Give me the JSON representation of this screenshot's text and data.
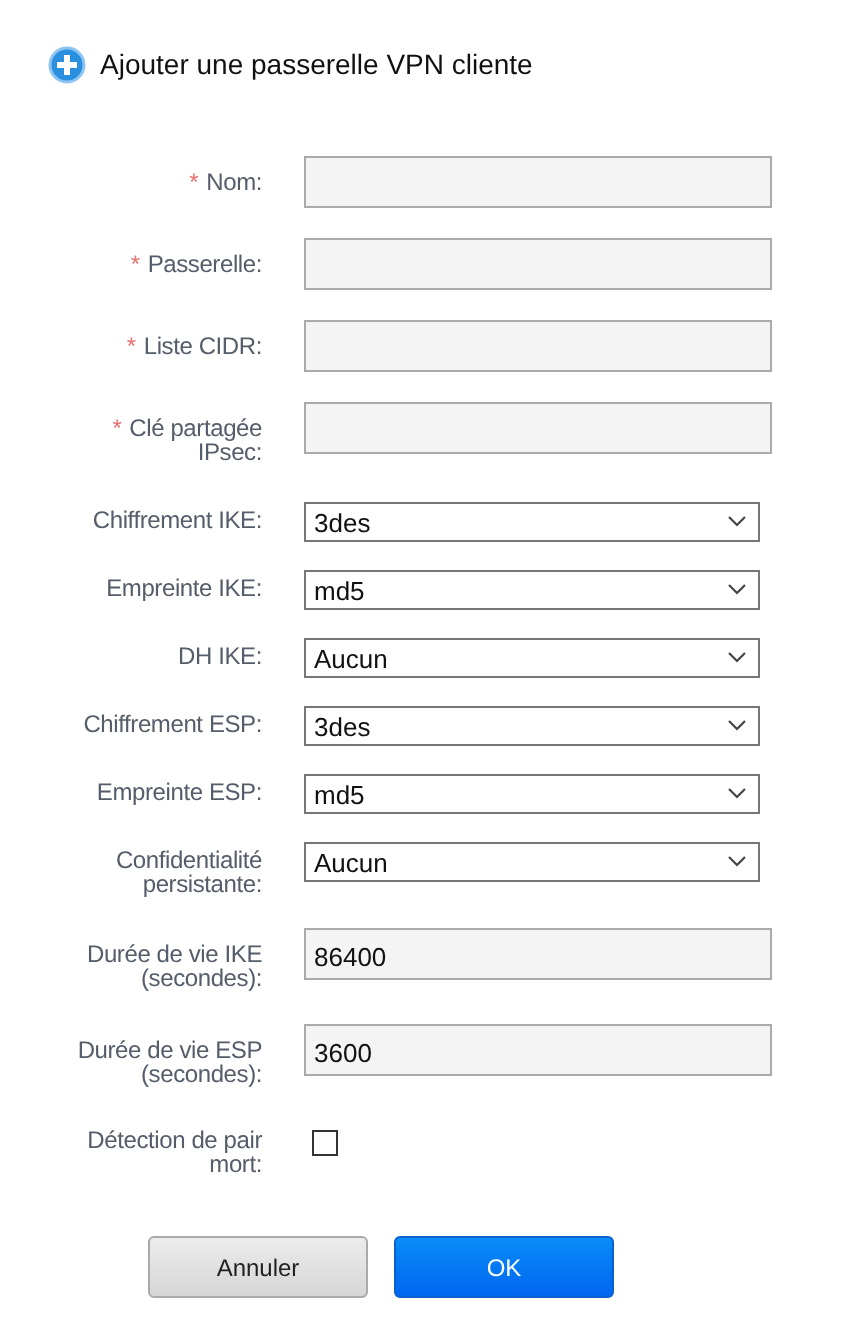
{
  "title": "Ajouter une passerelle VPN cliente",
  "fields": [
    {
      "kind": "text",
      "label": "Nom:",
      "mark": "*"
    },
    {
      "kind": "text",
      "label": "Passerelle:",
      "mark": "*"
    },
    {
      "kind": "text",
      "label": "Liste CIDR:",
      "mark": "*"
    },
    {
      "kind": "text",
      "label": "Clé partagée IPsec:",
      "mark": "*"
    },
    {
      "kind": "select",
      "label": "Chiffrement IKE:",
      "value": "3des"
    },
    {
      "kind": "select",
      "label": "Empreinte IKE:",
      "value": "md5"
    },
    {
      "kind": "select",
      "label": "DH IKE:",
      "value": "Aucun"
    },
    {
      "kind": "select",
      "label": "Chiffrement ESP:",
      "value": "3des"
    },
    {
      "kind": "select",
      "label": "Empreinte ESP:",
      "value": "md5"
    },
    {
      "kind": "select",
      "label": "Confidentialité persistante:",
      "value": "Aucun"
    },
    {
      "kind": "text",
      "label": "Durée de vie IKE (secondes):",
      "value": "86400"
    },
    {
      "kind": "text",
      "label": "Durée de vie ESP (secondes):",
      "value": "3600"
    },
    {
      "kind": "checkbox",
      "label": "Détection de pair mort:",
      "checked": false
    }
  ],
  "buttons": [
    {
      "label": "Annuler",
      "kind": "secondary"
    },
    {
      "label": "OK",
      "kind": "primary"
    }
  ]
}
